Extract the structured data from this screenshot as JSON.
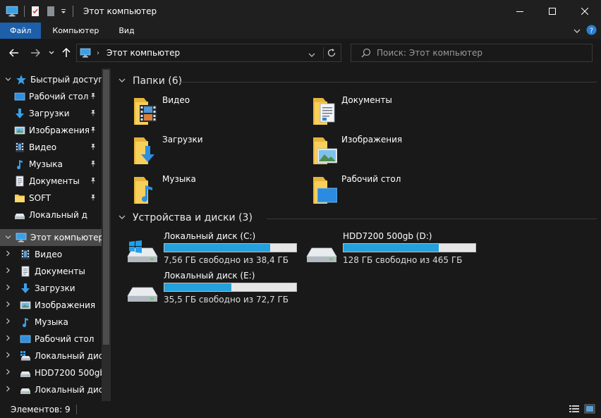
{
  "window": {
    "title": "Этот компьютер"
  },
  "ribbon": {
    "tabs": [
      {
        "label": "Файл",
        "active": true
      },
      {
        "label": "Компьютер",
        "active": false
      },
      {
        "label": "Вид",
        "active": false
      }
    ]
  },
  "address": {
    "crumb": "Этот компьютер"
  },
  "search": {
    "placeholder": "Поиск: Этот компьютер"
  },
  "nav": {
    "items": [
      {
        "label": "Быстрый доступ",
        "icon": "star-icon",
        "chevron": "down",
        "pinned": false,
        "selected": false
      },
      {
        "label": "Рабочий стол",
        "icon": "desktop-icon",
        "chevron": "",
        "pinned": true,
        "selected": false
      },
      {
        "label": "Загрузки",
        "icon": "download-arrow-icon",
        "chevron": "",
        "pinned": true,
        "selected": false
      },
      {
        "label": "Изображения",
        "icon": "pictures-icon",
        "chevron": "",
        "pinned": true,
        "selected": false
      },
      {
        "label": "Видео",
        "icon": "video-icon",
        "chevron": "",
        "pinned": true,
        "selected": false
      },
      {
        "label": "Музыка",
        "icon": "music-note-icon",
        "chevron": "",
        "pinned": true,
        "selected": false
      },
      {
        "label": "Документы",
        "icon": "documents-icon",
        "chevron": "",
        "pinned": true,
        "selected": false
      },
      {
        "label": "SOFT",
        "icon": "folder-icon",
        "chevron": "",
        "pinned": true,
        "selected": false
      },
      {
        "label": "Локальный д",
        "icon": "drive-icon",
        "chevron": "",
        "pinned": false,
        "selected": false
      },
      {
        "label": "Этот компьютер",
        "icon": "computer-icon",
        "chevron": "down",
        "pinned": false,
        "selected": true
      },
      {
        "label": "Видео",
        "icon": "video-icon",
        "chevron": "right",
        "pinned": false,
        "selected": false
      },
      {
        "label": "Документы",
        "icon": "documents-icon",
        "chevron": "right",
        "pinned": false,
        "selected": false
      },
      {
        "label": "Загрузки",
        "icon": "download-arrow-icon",
        "chevron": "right",
        "pinned": false,
        "selected": false
      },
      {
        "label": "Изображения",
        "icon": "pictures-icon",
        "chevron": "right",
        "pinned": false,
        "selected": false
      },
      {
        "label": "Музыка",
        "icon": "music-note-icon",
        "chevron": "right",
        "pinned": false,
        "selected": false
      },
      {
        "label": "Рабочий стол",
        "icon": "desktop-icon",
        "chevron": "right",
        "pinned": false,
        "selected": false
      },
      {
        "label": "Локальный дис",
        "icon": "windows-drive-icon",
        "chevron": "right",
        "pinned": false,
        "selected": false
      },
      {
        "label": "HDD7200 500gb",
        "icon": "drive-icon",
        "chevron": "right",
        "pinned": false,
        "selected": false
      },
      {
        "label": "Локальный дис",
        "icon": "drive-icon",
        "chevron": "right",
        "pinned": false,
        "selected": false
      }
    ]
  },
  "content": {
    "folders_group": "Папки (6)",
    "folders": [
      {
        "label": "Видео",
        "icon": "video-folder-icon"
      },
      {
        "label": "Документы",
        "icon": "documents-folder-icon"
      },
      {
        "label": "Загрузки",
        "icon": "downloads-folder-icon"
      },
      {
        "label": "Изображения",
        "icon": "pictures-folder-icon"
      },
      {
        "label": "Музыка",
        "icon": "music-folder-icon"
      },
      {
        "label": "Рабочий стол",
        "icon": "desktop-folder-icon"
      }
    ],
    "drives_group": "Устройства и диски (3)",
    "drives": [
      {
        "name": "Локальный диск (C:)",
        "free": "7,56 ГБ свободно из 38,4 ГБ",
        "used_fraction": 0.8,
        "icon": "windows-drive-icon"
      },
      {
        "name": "HDD7200 500gb (D:)",
        "free": "128 ГБ свободно из 465 ГБ",
        "used_fraction": 0.72,
        "icon": "drive-icon"
      },
      {
        "name": "Локальный диск (E:)",
        "free": "35,5 ГБ свободно из 72,7 ГБ",
        "used_fraction": 0.51,
        "icon": "drive-icon"
      }
    ]
  },
  "status": {
    "text": "Элементов: 9"
  },
  "colors": {
    "accent": "#1d5fa9",
    "bar_fill": "#26a0da",
    "folder_yellow": "#f5c84c"
  }
}
